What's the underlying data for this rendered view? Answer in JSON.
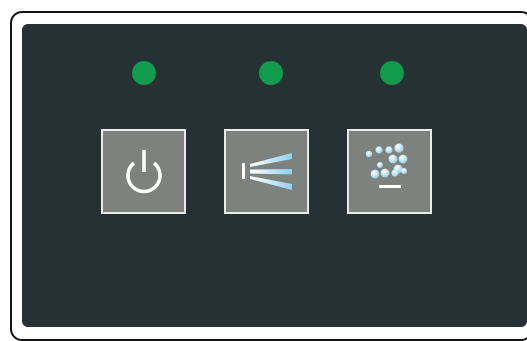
{
  "panel": {
    "leds": [
      {
        "id": "led-power",
        "state": "on",
        "color": "#119b4c"
      },
      {
        "id": "led-spray",
        "state": "on",
        "color": "#119b4c"
      },
      {
        "id": "led-bubbles",
        "state": "on",
        "color": "#119b4c"
      }
    ],
    "buttons": [
      {
        "id": "power",
        "icon": "power-icon"
      },
      {
        "id": "spray",
        "icon": "spray-jet-icon"
      },
      {
        "id": "bubbles",
        "icon": "bubbles-icon"
      }
    ],
    "colors": {
      "panel_background": "#263133",
      "button_face": "#7d827f",
      "button_border": "#e9ecea",
      "indicator_green": "#119b4c",
      "icon_light_blue": "#9fd6ee"
    }
  }
}
